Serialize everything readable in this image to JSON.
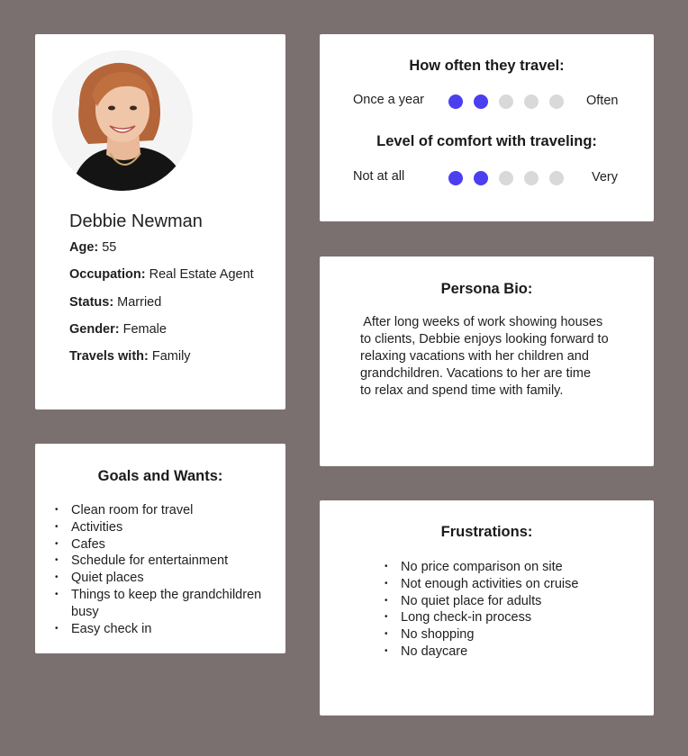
{
  "profile": {
    "name": "Debbie Newman",
    "fields": [
      {
        "label": "Age:",
        "value": "55"
      },
      {
        "label": "Occupation:",
        "value": "Real Estate Agent"
      },
      {
        "label": "Status:",
        "value": "Married"
      },
      {
        "label": "Gender:",
        "value": "Female"
      },
      {
        "label": "Travels with:",
        "value": "Family"
      }
    ]
  },
  "travel": {
    "frequency": {
      "title": "How often they travel:",
      "left_label": "Once a year",
      "right_label": "Often",
      "level": 2,
      "max": 5
    },
    "comfort": {
      "title": "Level of comfort with traveling:",
      "left_label": "Not at all",
      "right_label": "Very",
      "level": 2,
      "max": 5
    }
  },
  "bio": {
    "title": "Persona Bio:",
    "lines": [
      " After long weeks of work showing houses",
      "to clients, Debbie enjoys looking forward to",
      "relaxing vacations with her children and",
      "grandchildren. Vacations to her are time",
      "to relax and spend time with family."
    ]
  },
  "goals": {
    "title": "Goals and Wants:",
    "items": [
      "Clean room for travel",
      "Activities",
      "Cafes",
      "Schedule for entertainment",
      "Quiet places",
      "Things to keep the grandchildren busy",
      "Easy check in"
    ]
  },
  "frustrations": {
    "title": "Frustrations:",
    "items": [
      "No price comparison on site",
      "Not enough activities on cruise",
      "No quiet place for adults",
      "Long check-in process",
      "No shopping",
      "No daycare"
    ]
  },
  "colors": {
    "background": "#7b7070",
    "dot_filled": "#4b3ff0",
    "dot_empty": "#d9d9d9"
  }
}
